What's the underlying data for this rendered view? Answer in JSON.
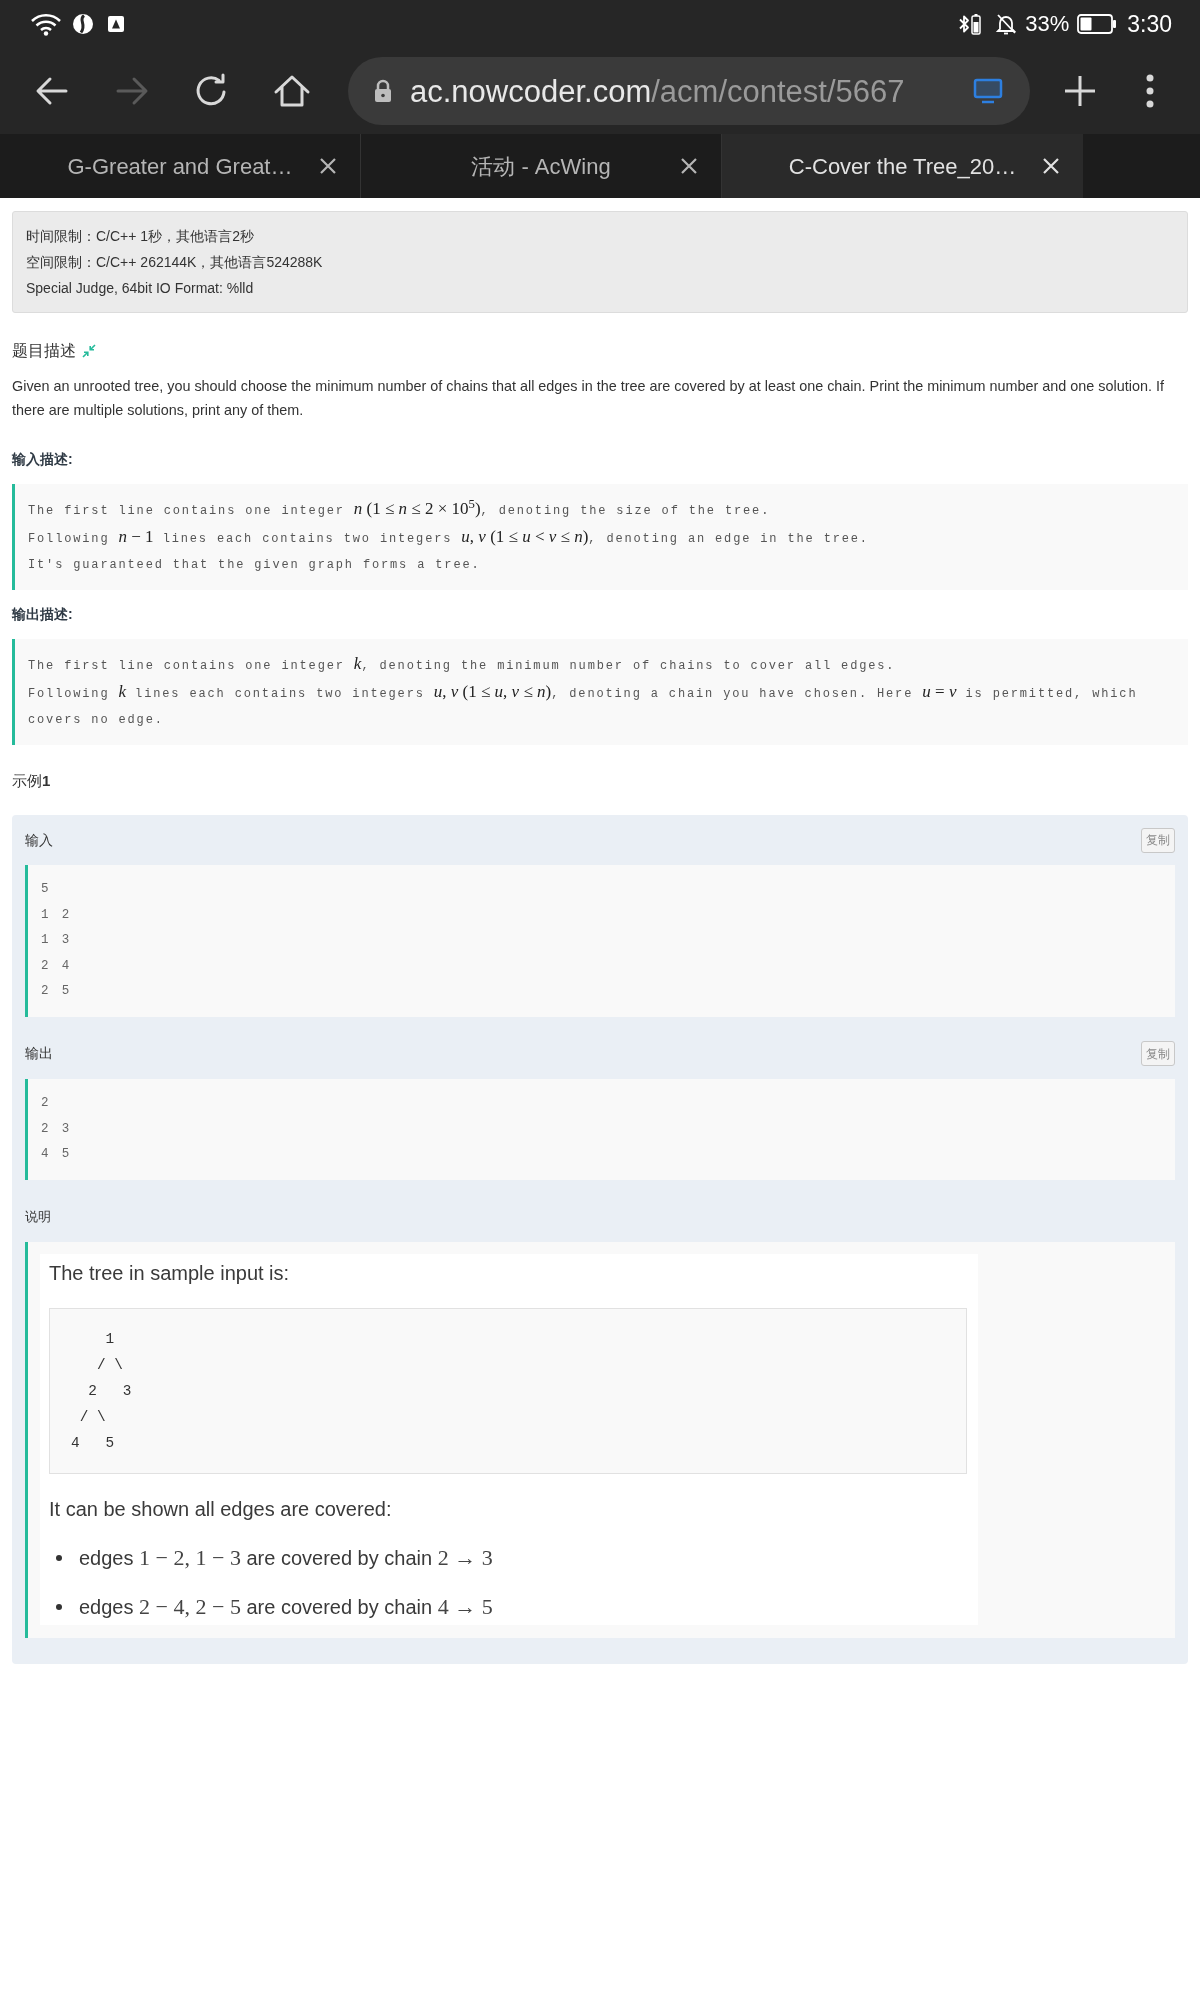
{
  "status_bar": {
    "battery": "33%",
    "time": "3:30"
  },
  "browser": {
    "nav_buttons": [
      {
        "kind": "back",
        "disabled": false
      },
      {
        "kind": "forward",
        "disabled": true
      },
      {
        "kind": "reload",
        "disabled": false
      },
      {
        "kind": "home",
        "disabled": false
      }
    ],
    "url": {
      "host": "ac.nowcoder.com",
      "path": "/acm/contest/5667"
    },
    "tabs": [
      {
        "title": "G-Greater and Great…",
        "selected": false
      },
      {
        "title": "活动 - AcWing",
        "selected": false
      },
      {
        "title": "C-Cover the Tree_20…",
        "selected": true
      }
    ]
  },
  "limits": [
    "时间限制：C/C++ 1秒，其他语言2秒",
    "空间限制：C/C++ 262144K，其他语言524288K",
    "Special Judge, 64bit IO Format: %lld"
  ],
  "description": {
    "title": "题目描述",
    "text": "Given an unrooted tree, you should choose the minimum number of chains that all edges in the tree are covered by at least one chain. Print the minimum number and one solution. If there are multiple solutions, print any of them."
  },
  "input_description": {
    "title": "输入描述:",
    "lines": [
      [
        {
          "kind": "text",
          "text": "The first line contains one integer "
        },
        {
          "kind": "math",
          "text": "*n* (1 ≤ *n* ≤ 2 × 10$^{5}$)"
        },
        {
          "kind": "text",
          "text": ", denoting the size of the tree."
        }
      ],
      [
        {
          "kind": "text",
          "text": "Following "
        },
        {
          "kind": "math",
          "text": "*n* − 1"
        },
        {
          "kind": "text",
          "text": " lines each contains two integers "
        },
        {
          "kind": "math",
          "text": "*u*, *v* (1 ≤ *u* < *v* ≤ *n*)"
        },
        {
          "kind": "text",
          "text": ", denoting an edge in the tree."
        }
      ],
      [
        {
          "kind": "text",
          "text": "It's guaranteed that the given graph forms a tree."
        }
      ]
    ]
  },
  "output_description": {
    "title": "输出描述:",
    "lines": [
      [
        {
          "kind": "text",
          "text": "The first line contains one integer "
        },
        {
          "kind": "math",
          "text": "*k*"
        },
        {
          "kind": "text",
          "text": ", denoting the minimum number of chains to cover all edges."
        }
      ],
      [
        {
          "kind": "text",
          "text": "Following "
        },
        {
          "kind": "math",
          "text": "*k*"
        },
        {
          "kind": "text",
          "text": " lines each contains two integers "
        },
        {
          "kind": "math",
          "text": "*u*, *v* (1 ≤ *u*, *v* ≤ *n*)"
        },
        {
          "kind": "text",
          "text": ", denoting a chain you have chosen. Here "
        },
        {
          "kind": "math",
          "text": "*u* = *v*"
        },
        {
          "kind": "text",
          "text": " is permitted, which covers no edge."
        }
      ]
    ]
  },
  "example": {
    "title": "示例**1**",
    "input": {
      "label": "输入",
      "copy_button": "复制",
      "lines": [
        "5",
        "1 2",
        "1 3",
        "2 4",
        "2 5"
      ]
    },
    "output": {
      "label": "输出",
      "copy_button": "复制",
      "lines": [
        "2",
        "2 3",
        "4 5"
      ]
    },
    "explanation": {
      "label": "说明",
      "intro": "The tree in sample input is:",
      "diagram": [
        "    1",
        "   / \\",
        "  2   3",
        " / \\",
        "4   5"
      ],
      "summary": "It can be shown all edges are covered:",
      "bullets": [
        [
          {
            "kind": "text",
            "text": "edges "
          },
          {
            "kind": "math",
            "text": "1 − 2, 1 − 3"
          },
          {
            "kind": "text",
            "text": " are covered by chain "
          },
          {
            "kind": "math",
            "text": "2 → 3"
          }
        ],
        [
          {
            "kind": "text",
            "text": "edges "
          },
          {
            "kind": "math",
            "text": "2 − 4, 2 − 5"
          },
          {
            "kind": "text",
            "text": " are covered by chain "
          },
          {
            "kind": "math",
            "text": "4 → 5"
          }
        ]
      ]
    }
  }
}
